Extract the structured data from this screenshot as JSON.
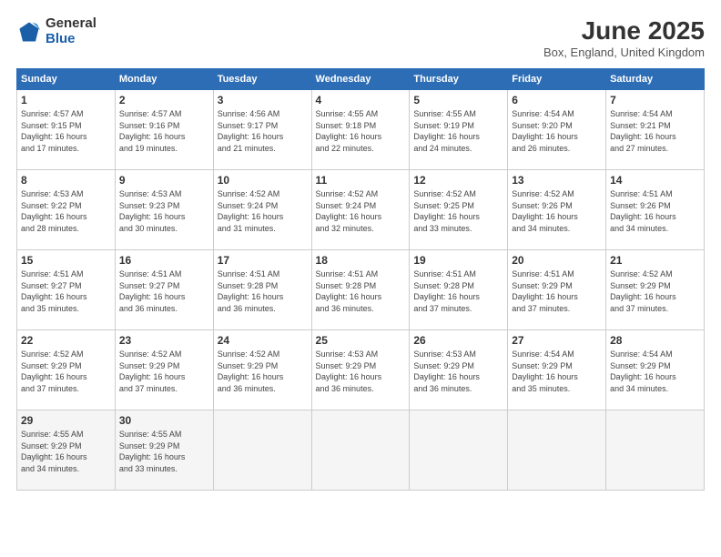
{
  "header": {
    "logo_line1": "General",
    "logo_line2": "Blue",
    "main_title": "June 2025",
    "subtitle": "Box, England, United Kingdom"
  },
  "calendar": {
    "days_of_week": [
      "Sunday",
      "Monday",
      "Tuesday",
      "Wednesday",
      "Thursday",
      "Friday",
      "Saturday"
    ],
    "weeks": [
      [
        {
          "day": "1",
          "info": "Sunrise: 4:57 AM\nSunset: 9:15 PM\nDaylight: 16 hours\nand 17 minutes."
        },
        {
          "day": "2",
          "info": "Sunrise: 4:57 AM\nSunset: 9:16 PM\nDaylight: 16 hours\nand 19 minutes."
        },
        {
          "day": "3",
          "info": "Sunrise: 4:56 AM\nSunset: 9:17 PM\nDaylight: 16 hours\nand 21 minutes."
        },
        {
          "day": "4",
          "info": "Sunrise: 4:55 AM\nSunset: 9:18 PM\nDaylight: 16 hours\nand 22 minutes."
        },
        {
          "day": "5",
          "info": "Sunrise: 4:55 AM\nSunset: 9:19 PM\nDaylight: 16 hours\nand 24 minutes."
        },
        {
          "day": "6",
          "info": "Sunrise: 4:54 AM\nSunset: 9:20 PM\nDaylight: 16 hours\nand 26 minutes."
        },
        {
          "day": "7",
          "info": "Sunrise: 4:54 AM\nSunset: 9:21 PM\nDaylight: 16 hours\nand 27 minutes."
        }
      ],
      [
        {
          "day": "8",
          "info": "Sunrise: 4:53 AM\nSunset: 9:22 PM\nDaylight: 16 hours\nand 28 minutes."
        },
        {
          "day": "9",
          "info": "Sunrise: 4:53 AM\nSunset: 9:23 PM\nDaylight: 16 hours\nand 30 minutes."
        },
        {
          "day": "10",
          "info": "Sunrise: 4:52 AM\nSunset: 9:24 PM\nDaylight: 16 hours\nand 31 minutes."
        },
        {
          "day": "11",
          "info": "Sunrise: 4:52 AM\nSunset: 9:24 PM\nDaylight: 16 hours\nand 32 minutes."
        },
        {
          "day": "12",
          "info": "Sunrise: 4:52 AM\nSunset: 9:25 PM\nDaylight: 16 hours\nand 33 minutes."
        },
        {
          "day": "13",
          "info": "Sunrise: 4:52 AM\nSunset: 9:26 PM\nDaylight: 16 hours\nand 34 minutes."
        },
        {
          "day": "14",
          "info": "Sunrise: 4:51 AM\nSunset: 9:26 PM\nDaylight: 16 hours\nand 34 minutes."
        }
      ],
      [
        {
          "day": "15",
          "info": "Sunrise: 4:51 AM\nSunset: 9:27 PM\nDaylight: 16 hours\nand 35 minutes."
        },
        {
          "day": "16",
          "info": "Sunrise: 4:51 AM\nSunset: 9:27 PM\nDaylight: 16 hours\nand 36 minutes."
        },
        {
          "day": "17",
          "info": "Sunrise: 4:51 AM\nSunset: 9:28 PM\nDaylight: 16 hours\nand 36 minutes."
        },
        {
          "day": "18",
          "info": "Sunrise: 4:51 AM\nSunset: 9:28 PM\nDaylight: 16 hours\nand 36 minutes."
        },
        {
          "day": "19",
          "info": "Sunrise: 4:51 AM\nSunset: 9:28 PM\nDaylight: 16 hours\nand 37 minutes."
        },
        {
          "day": "20",
          "info": "Sunrise: 4:51 AM\nSunset: 9:29 PM\nDaylight: 16 hours\nand 37 minutes."
        },
        {
          "day": "21",
          "info": "Sunrise: 4:52 AM\nSunset: 9:29 PM\nDaylight: 16 hours\nand 37 minutes."
        }
      ],
      [
        {
          "day": "22",
          "info": "Sunrise: 4:52 AM\nSunset: 9:29 PM\nDaylight: 16 hours\nand 37 minutes."
        },
        {
          "day": "23",
          "info": "Sunrise: 4:52 AM\nSunset: 9:29 PM\nDaylight: 16 hours\nand 37 minutes."
        },
        {
          "day": "24",
          "info": "Sunrise: 4:52 AM\nSunset: 9:29 PM\nDaylight: 16 hours\nand 36 minutes."
        },
        {
          "day": "25",
          "info": "Sunrise: 4:53 AM\nSunset: 9:29 PM\nDaylight: 16 hours\nand 36 minutes."
        },
        {
          "day": "26",
          "info": "Sunrise: 4:53 AM\nSunset: 9:29 PM\nDaylight: 16 hours\nand 36 minutes."
        },
        {
          "day": "27",
          "info": "Sunrise: 4:54 AM\nSunset: 9:29 PM\nDaylight: 16 hours\nand 35 minutes."
        },
        {
          "day": "28",
          "info": "Sunrise: 4:54 AM\nSunset: 9:29 PM\nDaylight: 16 hours\nand 34 minutes."
        }
      ],
      [
        {
          "day": "29",
          "info": "Sunrise: 4:55 AM\nSunset: 9:29 PM\nDaylight: 16 hours\nand 34 minutes."
        },
        {
          "day": "30",
          "info": "Sunrise: 4:55 AM\nSunset: 9:29 PM\nDaylight: 16 hours\nand 33 minutes."
        },
        {
          "day": "",
          "info": ""
        },
        {
          "day": "",
          "info": ""
        },
        {
          "day": "",
          "info": ""
        },
        {
          "day": "",
          "info": ""
        },
        {
          "day": "",
          "info": ""
        }
      ]
    ]
  }
}
